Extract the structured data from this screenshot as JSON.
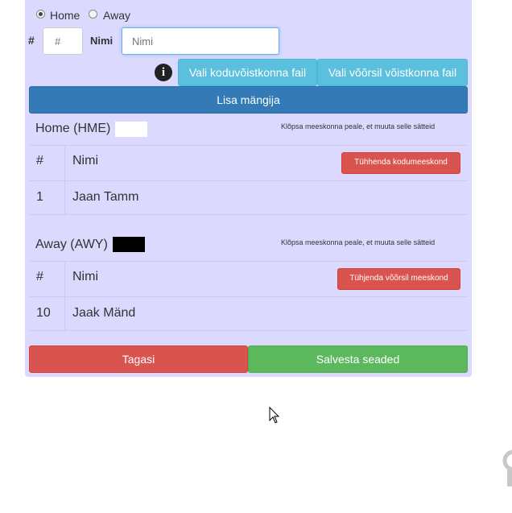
{
  "side_radio": {
    "home_label": "Home",
    "away_label": "Away",
    "selected": "Home"
  },
  "form": {
    "number_label": "#",
    "number_placeholder": "#",
    "name_label": "Nimi",
    "name_placeholder": "Nimi",
    "info_icon": "info-circle-icon",
    "home_file_button": "Vali koduvõistkonna fail",
    "away_file_button": "Vali võõrsil võistkonna fail",
    "add_player_button": "Lisa mängija"
  },
  "home_team": {
    "title": "Home (HME)",
    "color": "#ffffff",
    "hint": "Klõpsa meeskonna peale, et muuta selle sätteid",
    "col_number": "#",
    "col_name": "Nimi",
    "clear_button": "Tühhenda kodumeeskond",
    "players": [
      {
        "number": "1",
        "name": "Jaan Tamm"
      }
    ]
  },
  "away_team": {
    "title": "Away (AWY)",
    "color": "#000000",
    "hint": "Klõpsa meeskonna peale, et muuta selle sätteid",
    "col_number": "#",
    "col_name": "Nimi",
    "clear_button": "Tühjenda võõrsil meeskond",
    "players": [
      {
        "number": "10",
        "name": "Jaak Mänd"
      }
    ]
  },
  "footer": {
    "back_button": "Tagasi",
    "save_button": "Salvesta seaded"
  },
  "colors": {
    "panel_bg": "#dcd9fe",
    "info": "#5bc0de",
    "primary": "#337ab7",
    "danger": "#d9534f",
    "success": "#5cb85c"
  }
}
